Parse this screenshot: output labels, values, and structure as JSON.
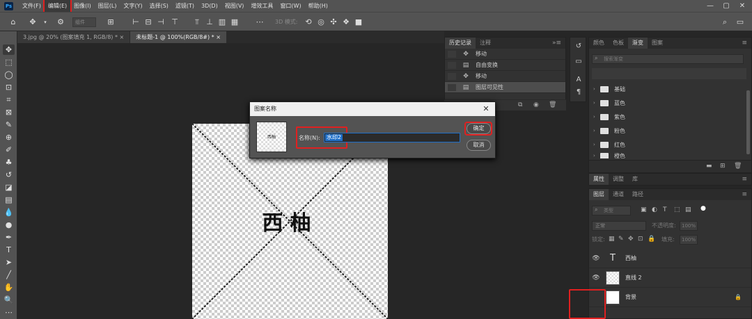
{
  "app": {
    "logo": "Ps"
  },
  "menubar": {
    "items": [
      "文件(F)",
      "编辑(E)",
      "图像(I)",
      "图层(L)",
      "文字(Y)",
      "选择(S)",
      "滤镜(T)",
      "3D(D)",
      "视图(V)",
      "增效工具",
      "窗口(W)",
      "帮助(H)"
    ],
    "active_index": 1,
    "minimize": "—",
    "maximize": "▢",
    "close": "✕"
  },
  "options": {
    "field_label": "组件",
    "mode_label": "3D 模式:"
  },
  "tabs": [
    {
      "label": "3.jpg @ 20% (图案填充 1, RGB/8) *",
      "close": "×"
    },
    {
      "label": "未标题-1 @ 100%(RGB/8#) *",
      "close": "×"
    }
  ],
  "canvas": {
    "text": "西柚"
  },
  "history": {
    "tabs": [
      "历史记录",
      "注释"
    ],
    "items": [
      {
        "icon": "move",
        "label": "移动"
      },
      {
        "icon": "doc",
        "label": "自由变换"
      },
      {
        "icon": "move",
        "label": "移动"
      },
      {
        "icon": "doc",
        "label": "图层可见性"
      }
    ],
    "current_index": 3
  },
  "dialog": {
    "title": "图案名称",
    "close": "✕",
    "name_label": "名称(N):",
    "name_value": "水印2",
    "ok_label": "确定",
    "cancel_label": "取消",
    "thumb_text": "西柚"
  },
  "swatches": {
    "tabs": [
      "颜色",
      "色板",
      "渐变",
      "图案"
    ],
    "active_index": 2,
    "search_placeholder": "搜索渐变",
    "folders": [
      "基础",
      "蓝色",
      "紫色",
      "粉色",
      "红色",
      "橙色"
    ]
  },
  "props": {
    "tabs": [
      "属性",
      "调整",
      "库"
    ]
  },
  "layers": {
    "tabs": [
      "图层",
      "通道",
      "路径"
    ],
    "kind_placeholder": "类型",
    "blend_mode": "正常",
    "opacity_label": "不透明度:",
    "opacity_value": "100%",
    "lock_label": "锁定:",
    "fill_label": "填充:",
    "fill_value": "100%",
    "items": [
      {
        "name": "西柚",
        "type": "text",
        "visible": true
      },
      {
        "name": "直线 2",
        "type": "shape",
        "visible": true
      },
      {
        "name": "背景",
        "type": "background",
        "visible": false,
        "locked": true
      }
    ]
  },
  "colors": {
    "highlight": "#e02020",
    "accent": "#1f6fc8"
  }
}
